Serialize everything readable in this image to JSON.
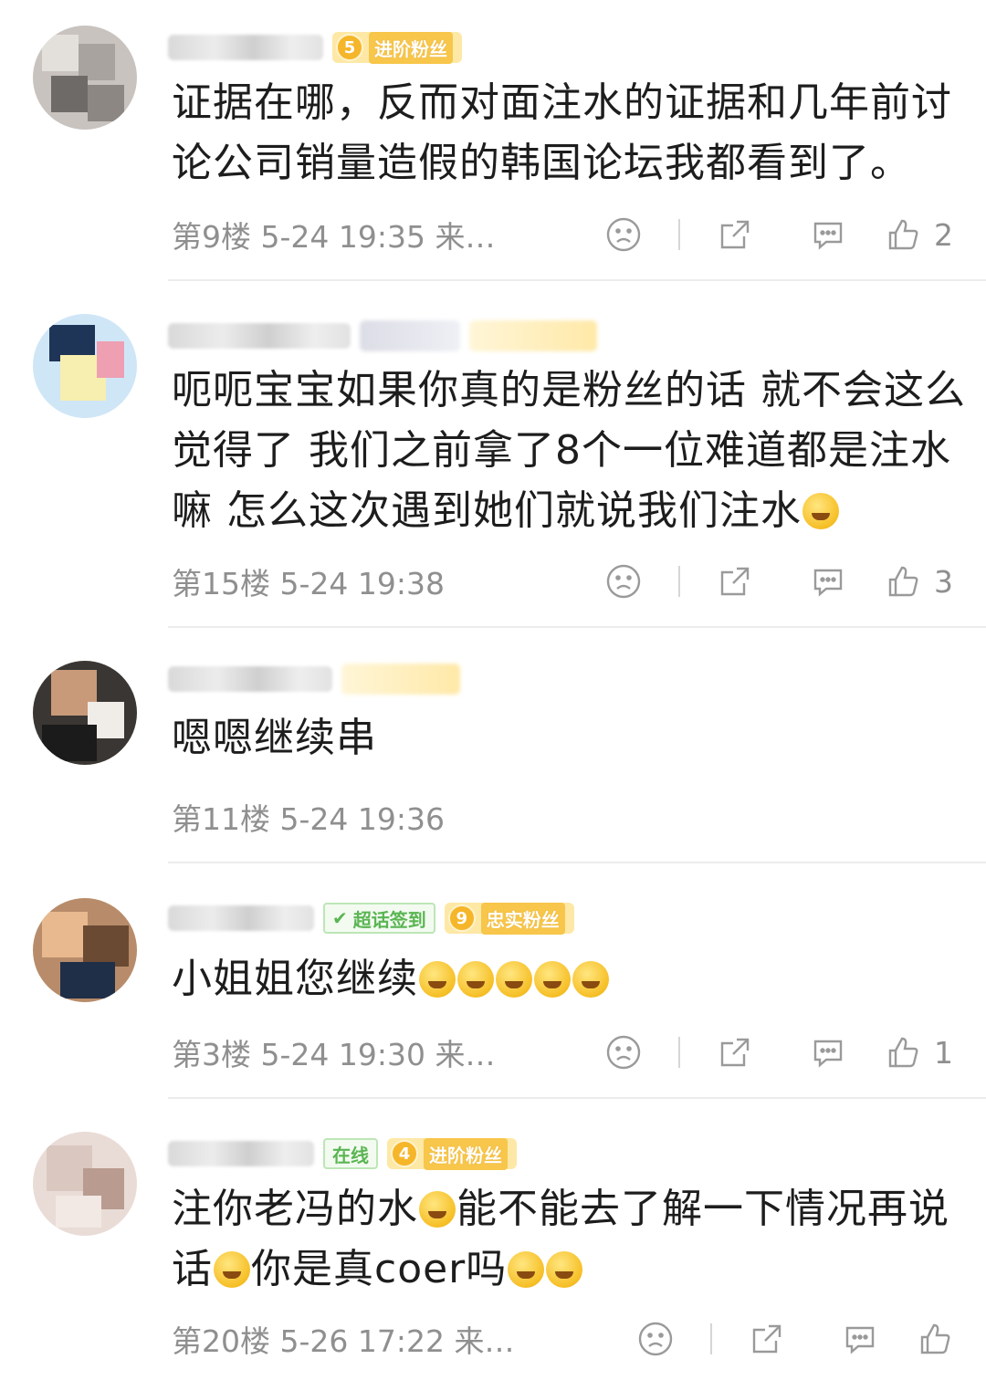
{
  "comments": [
    {
      "badge_level": "5",
      "badge_text": "进阶粉丝",
      "text": "证据在哪，反而对面注水的证据和几年前讨论公司销量造假的韩国论坛我都看到了。",
      "floor": "第9楼",
      "time": "5-24 19:35",
      "source": "来…",
      "likes": "2"
    },
    {
      "text_part1": "呃呃宝宝如果你真的是粉丝的话 就不会这么觉得了 我们之前拿了8个一位难道都是注水嘛 怎么这次遇到她们就说我们注水",
      "floor": "第15楼",
      "time": "5-24 19:38",
      "likes": "3"
    },
    {
      "text": "嗯嗯继续串",
      "floor": "第11楼",
      "time": "5-24 19:36"
    },
    {
      "badge_green": "超话签到",
      "badge_level": "9",
      "badge_text": "忠实粉丝",
      "text": "小姐姐您继续",
      "floor": "第3楼",
      "time": "5-24 19:30",
      "source": "来…",
      "likes": "1"
    },
    {
      "badge_green": "在线",
      "badge_level": "4",
      "badge_text": "进阶粉丝",
      "text_part1": "注你老冯的水",
      "text_part2": "能不能去了解一下情况再说话",
      "text_part3": "你是真coer吗",
      "floor": "第20楼",
      "time": "5-26 17:22",
      "source": "来…"
    }
  ],
  "icons": {
    "dislike": "sad-face-icon",
    "share": "share-icon",
    "reply": "comment-icon",
    "like": "thumbs-up-icon"
  },
  "colors": {
    "badge_gold": "#f6b62a",
    "badge_green": "#5ab552",
    "meta_grey": "#8f8f8f"
  }
}
